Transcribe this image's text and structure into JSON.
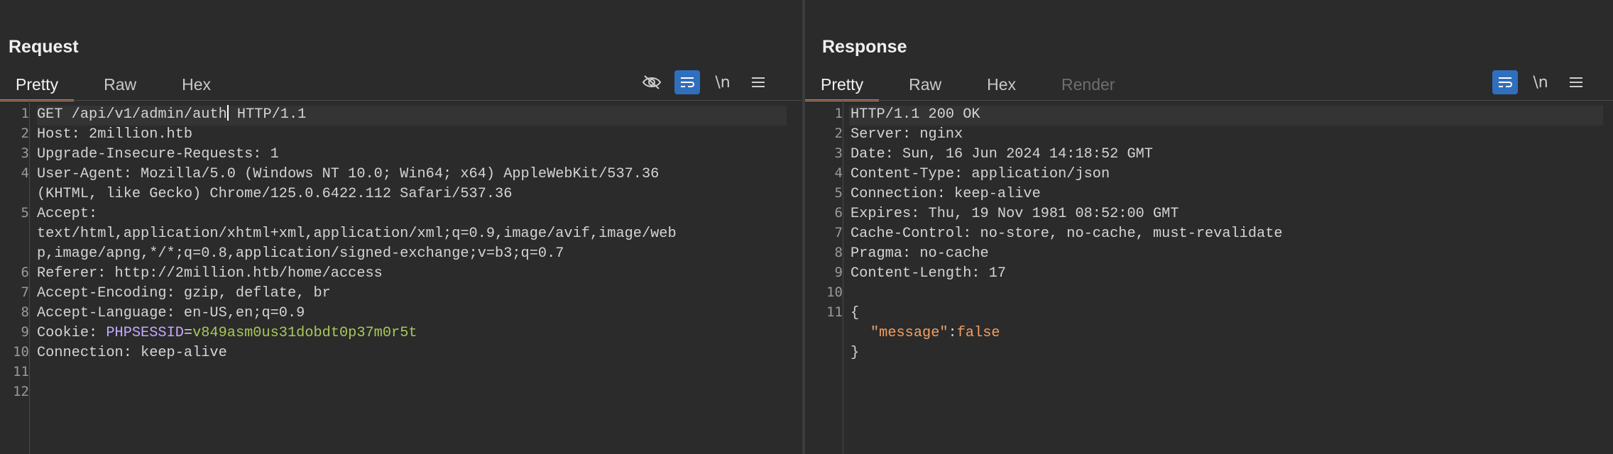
{
  "request": {
    "title": "Request",
    "tabs": [
      {
        "label": "Pretty",
        "active": true
      },
      {
        "label": "Raw"
      },
      {
        "label": "Hex"
      }
    ],
    "tools": [
      {
        "icon": "eye-slash-icon"
      },
      {
        "icon": "wrap-lines-icon",
        "active": true
      },
      {
        "label": "\\n"
      },
      {
        "icon": "menu-icon"
      }
    ],
    "line_numbers": [
      "1",
      "2",
      "3",
      "4",
      "5",
      "6",
      "7",
      "8",
      "9",
      "10",
      "11",
      "12"
    ],
    "lines": {
      "l1a": "GET /api/v1/admin/auth",
      "l1b": " HTTP/1.1",
      "l2": "Host: 2million.htb",
      "l3": "Upgrade-Insecure-Requests: 1",
      "l4a": "User-Agent: Mozilla/5.0 (Windows NT 10.0; Win64; x64) AppleWebKit/537.36",
      "l4b": "(KHTML, like Gecko) Chrome/125.0.6422.112 Safari/537.36",
      "l5a": "Accept:",
      "l5b": "text/html,application/xhtml+xml,application/xml;q=0.9,image/avif,image/web",
      "l5c": "p,image/apng,*/*;q=0.8,application/signed-exchange;v=b3;q=0.7",
      "l6": "Referer: http://2million.htb/home/access",
      "l7": "Accept-Encoding: gzip, deflate, br",
      "l8": "Accept-Language: en-US,en;q=0.9",
      "l9_prefix": "Cookie: ",
      "l9_name": "PHPSESSID",
      "l9_eq": "=",
      "l9_value": "v849asm0us31dobdt0p37m0r5t",
      "l10": "Connection: keep-alive"
    }
  },
  "response": {
    "title": "Response",
    "tabs": [
      {
        "label": "Pretty",
        "active": true
      },
      {
        "label": "Raw"
      },
      {
        "label": "Hex"
      },
      {
        "label": "Render",
        "disabled": true
      }
    ],
    "tools": [
      {
        "icon": "wrap-lines-icon",
        "active": true
      },
      {
        "label": "\\n"
      },
      {
        "icon": "menu-icon"
      }
    ],
    "line_numbers": [
      "1",
      "2",
      "3",
      "4",
      "5",
      "6",
      "7",
      "8",
      "9",
      "10",
      "11"
    ],
    "lines": {
      "l1": "HTTP/1.1 200 OK",
      "l2": "Server: nginx",
      "l3": "Date: Sun, 16 Jun 2024 14:18:52 GMT",
      "l4": "Content-Type: application/json",
      "l5": "Connection: keep-alive",
      "l6": "Expires: Thu, 19 Nov 1981 08:52:00 GMT",
      "l7": "Cache-Control: no-store, no-cache, must-revalidate",
      "l8": "Pragma: no-cache",
      "l9": "Content-Length: 17",
      "l11a": "{",
      "l11b_key": "\"message\"",
      "l11b_colon": ":",
      "l11b_val": "false",
      "l11c": "}"
    }
  },
  "layout_buttons": [
    {
      "icon": "side-by-side-layout-icon",
      "active": true
    },
    {
      "icon": "top-bottom-layout-icon"
    },
    {
      "icon": "single-pane-layout-icon"
    }
  ]
}
